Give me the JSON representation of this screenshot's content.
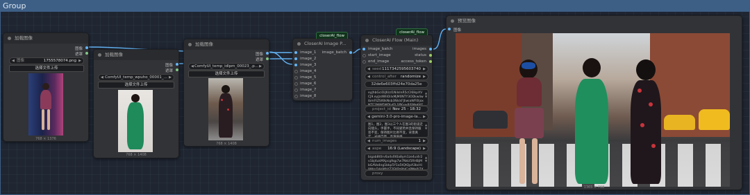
{
  "canvas": {
    "group_title": "Group"
  },
  "colors": {
    "group": "#3d5f86",
    "node_bg": "#323337",
    "tag_bg": "#11331c",
    "image_link": "#64b5f6"
  },
  "nodes": {
    "load1": {
      "title": "加载图像",
      "outputs": [
        "图像",
        "遮罩"
      ],
      "image_label": "图像",
      "image_value": "1755578074.png",
      "upload_label": "选择文件上传",
      "size": "768 × 1376"
    },
    "load2": {
      "title": "加载图像",
      "outputs": [
        "图像",
        "遮罩"
      ],
      "image_value": "ComfyUI_temp_wpuho_00001_...",
      "upload_label": "选择文件上传",
      "size": "768 × 1408"
    },
    "load3": {
      "title": "加载图像",
      "outputs": [
        "图像",
        "遮罩"
      ],
      "image_value": "ComfyUI_temp_idlpm_00023_.p...",
      "upload_label": "选择文件上传",
      "size": "768 × 1408"
    },
    "image_p": {
      "title": "CloserAI Image P...",
      "tag": "closerAI_flow",
      "inputs": [
        "image_1",
        "image_2",
        "image_3",
        "image_4",
        "image_5",
        "image_6",
        "image_7",
        "image_8"
      ],
      "output": "image_batch"
    },
    "flow": {
      "title": "CloserAI Flow (Main)",
      "tag": "closerAI_flow",
      "inputs": [
        "image_batch",
        "start_image",
        "end_image"
      ],
      "outputs": [
        "images",
        "status",
        "access_token"
      ],
      "seed_label": "seed",
      "seed_value": "1117342595603740",
      "control_label": "control_after",
      "control_value": "randomize",
      "hash": "32de6e603ffd24e70da25e",
      "token_text": "eyJhbGciOiJIUzI1NiIsInR5cCI6IkpXVCJ9.eyJzdWIiOiIxMjM0NTY3ODkwIiwibmFtZSI6IkNsb3NlckFJIiwiaWF0IjoxNTE2MjM5MDIyfQ.SflKxwRJSMeKKF2QT4fwpMeJf36POk6yJV",
      "project_label": "project_id",
      "project_value": "Nov 25 - 18:32",
      "model_value": "gemini-3.0-pro-image-la...",
      "prompt_text": "图1，图2，图3以三个人在图3的街道走向镜头，手握手，不同姿势并且保持服装不变，保持图片比例不变，背景真实，光线自然，高清质感",
      "num_label": "num_images",
      "num_value": "1",
      "aspect_label": "aspe",
      "aspect_value": "16:9 (Landscape)",
      "key_text": "bigab8t0rv6a4v0t0a8ym1ze4ui4r2v1bj4ukMXpcg9qp7w7NkU5RHBjMbGAVa4ng1bkp5Y1a5tQtQpA3bcHi9Wrn5Ak9fbYZ2EKPz8bJCqPMe0l7Xi",
      "proxy_label": "proxy"
    },
    "preview": {
      "title": "预览图像",
      "input": "图像",
      "size": "1365 × 768"
    }
  }
}
